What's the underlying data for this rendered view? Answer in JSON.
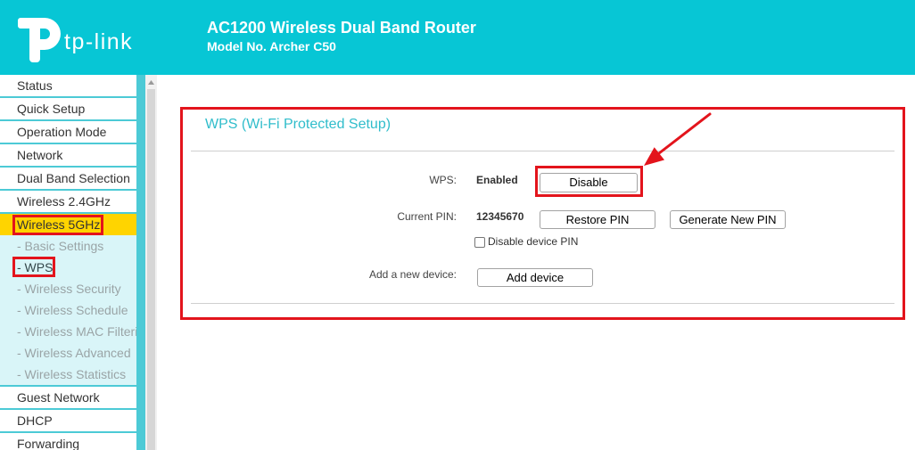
{
  "colors": {
    "header_bg": "#07c6d5",
    "menu_border": "#4ccad6",
    "active_item_bg": "#ffd400",
    "submenu_bg": "#d9f5f8",
    "section_title": "#30bdcb",
    "annotation_red": "#e3141c",
    "submenu_text": "#9aa4a6",
    "submenu_active_text": "#34474b"
  },
  "header": {
    "logo_icon": "tp-link-logo-icon",
    "logo_text": "tp-link",
    "product_title": "AC1200 Wireless Dual Band Router",
    "model": "Model No. Archer C50"
  },
  "sidebar": {
    "items": [
      {
        "label": "Status"
      },
      {
        "label": "Quick Setup"
      },
      {
        "label": "Operation Mode"
      },
      {
        "label": "Network"
      },
      {
        "label": "Dual Band Selection"
      },
      {
        "label": "Wireless 2.4GHz"
      },
      {
        "label": "Wireless 5GHz",
        "active": true
      }
    ],
    "submenu": [
      {
        "label": "- Basic Settings"
      },
      {
        "label": "- WPS",
        "active": true
      },
      {
        "label": "- Wireless Security"
      },
      {
        "label": "- Wireless Schedule"
      },
      {
        "label": "- Wireless MAC Filteri"
      },
      {
        "label": "- Wireless Advanced"
      },
      {
        "label": "- Wireless Statistics"
      }
    ],
    "items_after": [
      {
        "label": "Guest Network"
      },
      {
        "label": "DHCP"
      },
      {
        "label": "Forwarding"
      }
    ],
    "scroll_icon": "scroll-up-arrow-icon"
  },
  "wps": {
    "title": "WPS (Wi-Fi Protected Setup)",
    "wps_label": "WPS:",
    "wps_status": "Enabled",
    "disable_button": "Disable",
    "pin_label": "Current PIN:",
    "pin_value": "12345670",
    "restore_pin_button": "Restore PIN",
    "generate_pin_button": "Generate New PIN",
    "disable_pin_label": "Disable device PIN",
    "disable_pin_checked": false,
    "add_device_label": "Add a new device:",
    "add_device_button": "Add device"
  },
  "annotations": {
    "arrow_icon": "red-arrow-icon",
    "highlighted": [
      "Wireless 5GHz",
      "- WPS",
      "WPS panel",
      "Disable"
    ]
  }
}
